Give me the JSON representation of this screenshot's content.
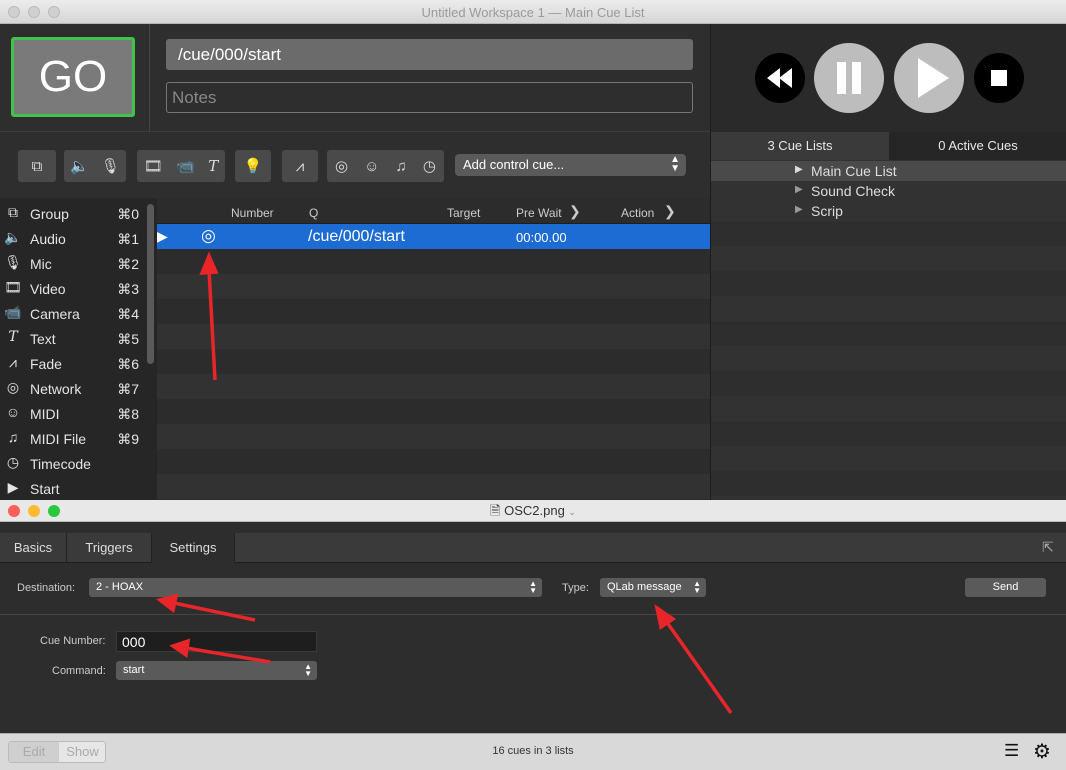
{
  "window": {
    "title": "Untitled Workspace 1 — Main Cue List"
  },
  "go_label": "GO",
  "cue": {
    "name": "/cue/000/start",
    "notes_placeholder": "Notes"
  },
  "toolbar": {
    "add_control_cue": "Add control cue..."
  },
  "sidebar": {
    "items": [
      {
        "label": "Group",
        "shortcut": "⌘0",
        "icon": "group-icon"
      },
      {
        "label": "Audio",
        "shortcut": "⌘1",
        "icon": "audio-icon"
      },
      {
        "label": "Mic",
        "shortcut": "⌘2",
        "icon": "mic-icon"
      },
      {
        "label": "Video",
        "shortcut": "⌘3",
        "icon": "video-icon"
      },
      {
        "label": "Camera",
        "shortcut": "⌘4",
        "icon": "camera-icon"
      },
      {
        "label": "Text",
        "shortcut": "⌘5",
        "icon": "text-icon"
      },
      {
        "label": "Fade",
        "shortcut": "⌘6",
        "icon": "fade-icon"
      },
      {
        "label": "Network",
        "shortcut": "⌘7",
        "icon": "network-icon"
      },
      {
        "label": "MIDI",
        "shortcut": "⌘8",
        "icon": "midi-icon"
      },
      {
        "label": "MIDI File",
        "shortcut": "⌘9",
        "icon": "midi-file-icon"
      },
      {
        "label": "Timecode",
        "shortcut": "",
        "icon": "timecode-icon"
      },
      {
        "label": "Start",
        "shortcut": "",
        "icon": "start-icon"
      }
    ]
  },
  "cue_list": {
    "columns": {
      "number": "Number",
      "q": "Q",
      "target": "Target",
      "pre_wait": "Pre Wait",
      "action": "Action"
    },
    "rows": [
      {
        "number": "",
        "q": "/cue/000/start",
        "target": "",
        "pre_wait": "00:00.00",
        "action": ""
      }
    ]
  },
  "right_panel": {
    "tabs": [
      "3 Cue Lists",
      "0 Active Cues"
    ],
    "cue_lists": [
      "Main Cue List",
      "Sound Check",
      "Scrip"
    ]
  },
  "inspector": {
    "file_title": "OSC2.png",
    "tabs": [
      "Basics",
      "Triggers",
      "Settings"
    ],
    "destination_label": "Destination:",
    "destination_value": "2 - HOAX",
    "type_label": "Type:",
    "type_value": "QLab message",
    "send_label": "Send",
    "cue_number_label": "Cue Number:",
    "cue_number_value": "000",
    "command_label": "Command:",
    "command_value": "start"
  },
  "status_bar": {
    "edit": "Edit",
    "show": "Show",
    "summary": "16 cues in 3 lists"
  },
  "colors": {
    "go_border": "#3ec44b",
    "selection": "#1c6cd4",
    "annotation_arrow": "#e8262a"
  }
}
